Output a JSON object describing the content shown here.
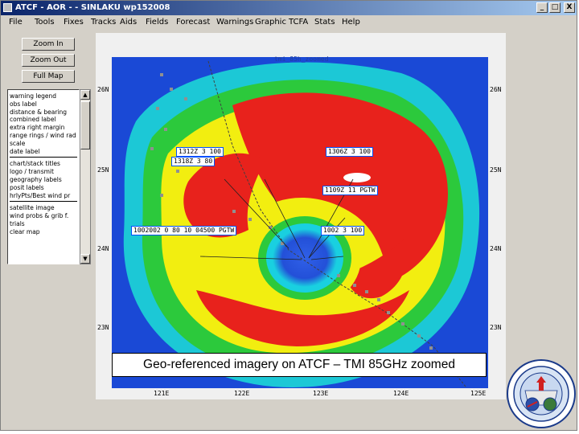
{
  "window": {
    "title": "ATCF - AOR - - SINLAKU wp152008",
    "minimize": "_",
    "maximize": "□",
    "close": "X"
  },
  "menu": [
    {
      "label": "File"
    },
    {
      "label": "Tools"
    },
    {
      "label": "Fixes"
    },
    {
      "label": "Tracks"
    },
    {
      "label": "Aids"
    },
    {
      "label": "Fields"
    },
    {
      "label": "Forecast"
    },
    {
      "label": "Warnings"
    },
    {
      "label": "Graphic"
    },
    {
      "label": "TCFA"
    },
    {
      "label": "Stats"
    },
    {
      "label": "Help"
    }
  ],
  "left_panel": {
    "zoom_in": "Zoom In",
    "zoom_out": "Zoom Out",
    "full_map": "Full Map",
    "options": [
      "warning legend",
      "obs label",
      "distance & bearing",
      "combined label",
      "extra right margin",
      "range rings / wind rad",
      "scale",
      "date label"
    ],
    "options2": [
      "chart/stack titles",
      "logo / transmit",
      "geography labels",
      "posit labels",
      "hrlyPts/Best wind pr"
    ],
    "options3": [
      "satellite image",
      "wind probs & grib f.",
      "trials",
      "clear map"
    ]
  },
  "map": {
    "image_name": "tmi_85h_zoomed",
    "lat_labels": [
      "26N",
      "25N",
      "24N",
      "23N"
    ],
    "lon_labels": [
      "121E",
      "122E",
      "123E",
      "124E",
      "125E"
    ],
    "fixes": [
      "1312Z 3 100",
      "1318Z 3 80",
      "1306Z 3 100",
      "1109Z 11 PGTW",
      "1002002 0 80 10 04500 PGTW",
      "1002 3 100"
    ]
  },
  "caption": "Geo-referenced imagery on ATCF – TMI 85GHz zoomed",
  "colors": {
    "ocean_blue": "#1a49d6",
    "rain_red": "#e8221c",
    "ring_yellow": "#f2ee10",
    "ring_green": "#2cc93c"
  },
  "icons": {
    "logo": "joint-typhoon-warning-center-seal"
  }
}
